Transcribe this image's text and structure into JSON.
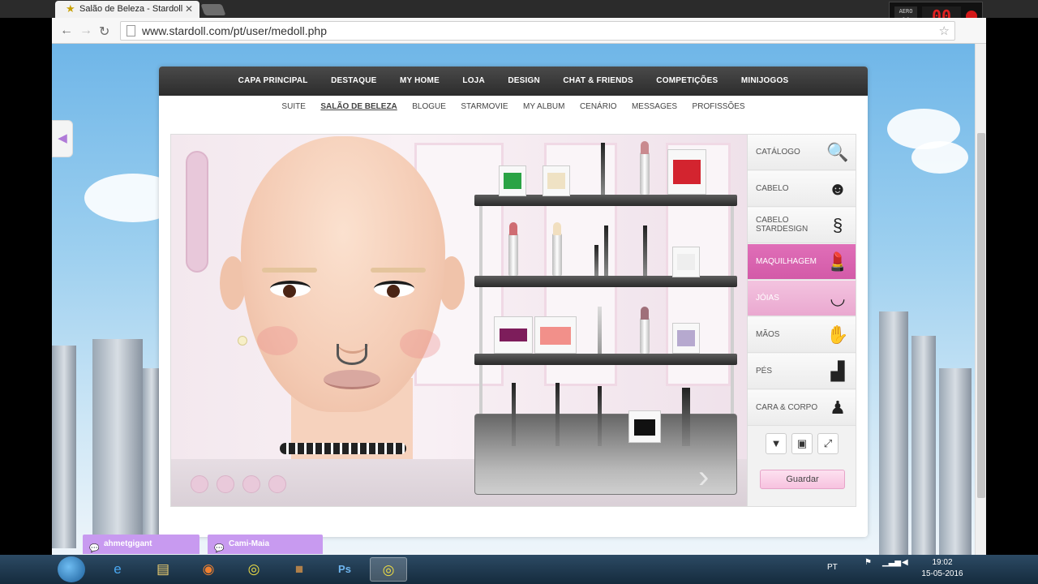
{
  "browser": {
    "tab_title": "Salão de Beleza - Stardoll",
    "url": "www.stardoll.com/pt/user/medoll.php"
  },
  "recorder": {
    "small_label": "00",
    "big_label": "00",
    "mode": "AERO"
  },
  "main_nav": [
    "CAPA PRINCIPAL",
    "DESTAQUE",
    "MY HOME",
    "LOJA",
    "DESIGN",
    "CHAT & FRIENDS",
    "COMPETIÇÕES",
    "MINIJOGOS"
  ],
  "sub_nav": {
    "items": [
      "SUITE",
      "SALÃO DE BELEZA",
      "BLOGUE",
      "STARMOVIE",
      "MY ALBUM",
      "CENÁRIO",
      "MESSAGES",
      "PROFISSÕES"
    ],
    "active": "SALÃO DE BELEZA"
  },
  "side_menu": {
    "items": [
      {
        "label": "CATÁLOGO",
        "icon": "magnifier-icon"
      },
      {
        "label": "CABELO",
        "icon": "hair-icon"
      },
      {
        "label": "CABELO STARDESIGN",
        "icon": "hair-design-icon"
      },
      {
        "label": "MAQUILHAGEM",
        "icon": "makeup-icon"
      },
      {
        "label": "JÓIAS",
        "icon": "jewelry-icon"
      },
      {
        "label": "MÃOS",
        "icon": "hand-icon"
      },
      {
        "label": "PÉS",
        "icon": "foot-icon"
      },
      {
        "label": "CARA & CORPO",
        "icon": "body-icon"
      }
    ],
    "selected": "MAQUILHAGEM",
    "save_label": "Guardar"
  },
  "chats": [
    "ahmetgigant",
    "Cami-Maia"
  ],
  "taskbar": {
    "language": "PT",
    "time": "19:02",
    "date": "15-05-2016"
  },
  "colors": {
    "accent_pink": "#d35aa8",
    "nav_dark": "#2c2c2c",
    "chat_purple": "#c89af0"
  }
}
